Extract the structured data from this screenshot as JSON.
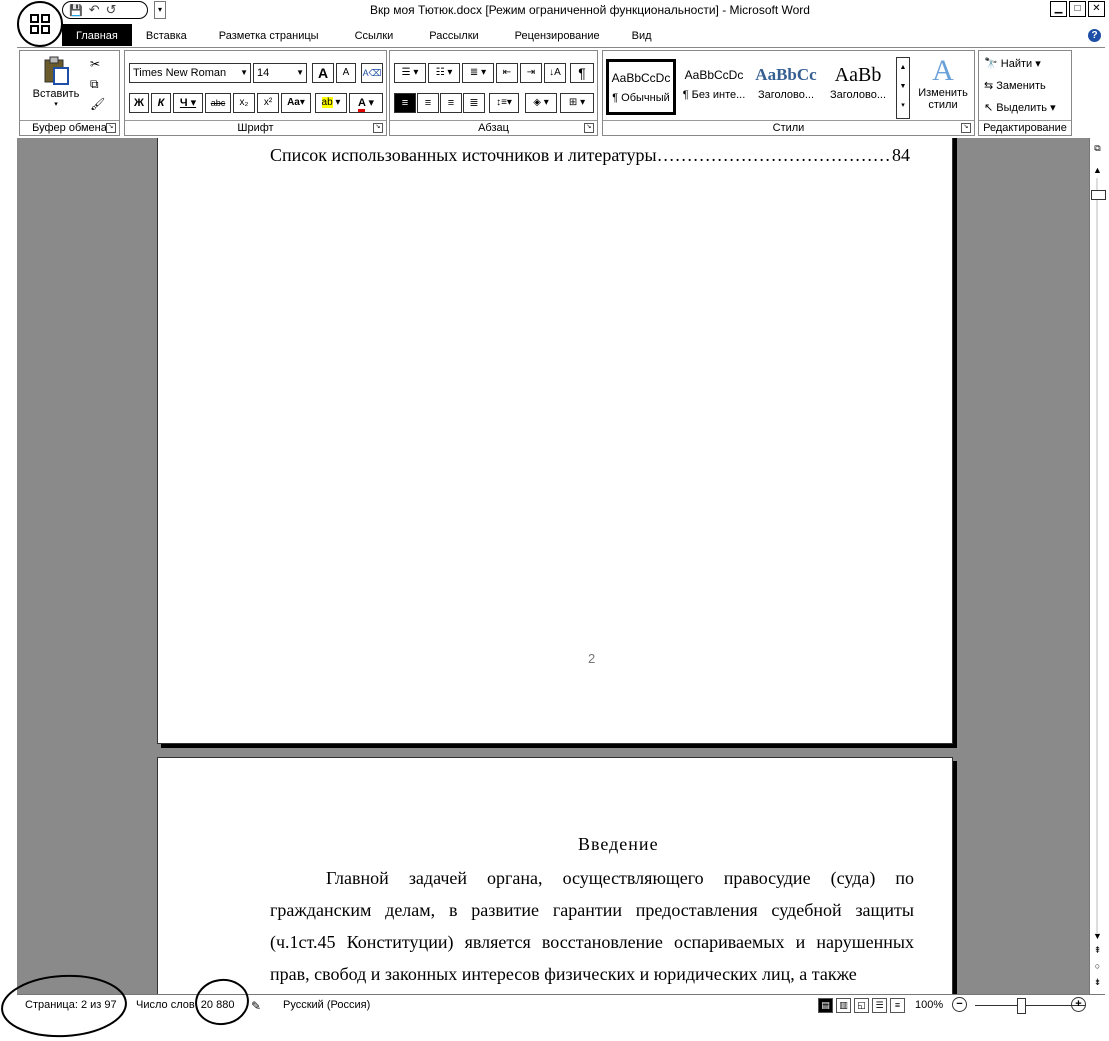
{
  "window": {
    "title": "Вкр моя Тютюк.docx [Режим ограниченной функциональности] - Microsoft Word",
    "minimize": "▁",
    "maximize": "□",
    "close": "✕"
  },
  "office_button_icon": "office-logo-icon",
  "qat": {
    "save": "💾",
    "undo": "↶",
    "redo": "↺",
    "more": "▾"
  },
  "tabs": [
    {
      "label": "Главная",
      "active": true
    },
    {
      "label": "Вставка"
    },
    {
      "label": "Разметка страницы"
    },
    {
      "label": "Ссылки"
    },
    {
      "label": "Рассылки"
    },
    {
      "label": "Рецензирование"
    },
    {
      "label": "Вид"
    }
  ],
  "help": "?",
  "ribbon": {
    "clipboard": {
      "paste_label": "Вставить",
      "group_label": "Буфер обмена"
    },
    "font": {
      "name": "Times New Roman",
      "size": "14",
      "grow": "A",
      "shrink": "A",
      "bold": "Ж",
      "italic": "К",
      "underline": "Ч",
      "strike": "abc",
      "subscript": "x₂",
      "superscript": "x²",
      "case": "Aa",
      "highlight": "ab",
      "color": "A",
      "group_label": "Шрифт"
    },
    "paragraph": {
      "pilcrow": "¶",
      "group_label": "Абзац"
    },
    "styles": {
      "items": [
        {
          "sample": "AaBbCcDc",
          "name": "¶ Обычный"
        },
        {
          "sample": "AaBbCcDc",
          "name": "¶ Без инте..."
        },
        {
          "sample": "AaBbCc",
          "name": "Заголово..."
        },
        {
          "sample": "AaBb",
          "name": "Заголово..."
        }
      ],
      "change_styles": "Изменить стили",
      "group_label": "Стили"
    },
    "editing": {
      "find": "Найти",
      "replace": "Заменить",
      "select": "Выделить",
      "group_label": "Редактирование"
    }
  },
  "document": {
    "toc_line_text": "Список использованных источников и литературы",
    "toc_line_dots": "……………………………………………………………",
    "toc_line_page": "84",
    "page_number": "2",
    "heading": "Введение",
    "body": "Главной задачей органа, осуществляющего правосудие (суда) по гражданским делам, в развитие гарантии предоставления судебной защиты (ч.1ст.45 Конституции) является восстановление оспариваемых и нарушенных прав, свобод и законных интересов физических и юридических лиц, а также"
  },
  "status": {
    "page": "Страница: 2 из 97",
    "words": "Число слов: 20 880",
    "language": "Русский (Россия)",
    "zoom": "100%",
    "zoom_out": "−",
    "zoom_in": "+"
  }
}
